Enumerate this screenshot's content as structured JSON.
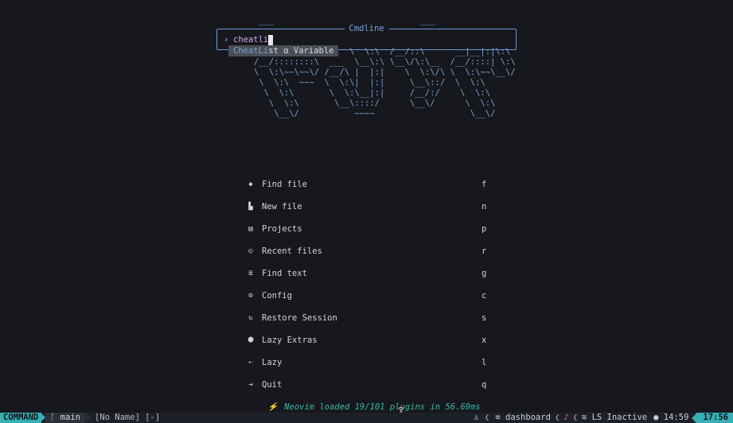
{
  "ascii_art": [
    "    ___                             ___",
    "",
    "",
    "    _____\\__\\:\\       \\  \\:\\  /__/::\\      __|__|:|\\:\\",
    "   /__/::::::::\\  ___  \\__\\:\\ \\__\\/\\:\\__  /__/::::| \\:\\",
    "   \\  \\:\\~~\\~~\\/ /__/\\ |  |:|    \\  \\:\\/\\ \\  \\:\\~~\\__\\/",
    "    \\  \\:\\  ~~~  \\  \\:\\|  |:|     \\__\\::/  \\  \\:\\",
    "     \\  \\:\\       \\  \\:\\__|:|     /__/:/    \\  \\:\\",
    "      \\  \\:\\       \\__\\::::/      \\__\\/      \\  \\:\\",
    "       \\__\\/           ~~~~                   \\__\\/"
  ],
  "cmdline": {
    "title": "Cmdline",
    "prompt": "›",
    "input": "cheatli"
  },
  "completion": {
    "match": "CheatLi",
    "rest": "st",
    "kind_icon": "α",
    "kind": "Variable"
  },
  "menu": [
    {
      "icon": "file-search-icon",
      "glyph": "◆",
      "label": "Find file",
      "key": "f"
    },
    {
      "icon": "new-file-icon",
      "glyph": "▙",
      "label": "New file",
      "key": "n"
    },
    {
      "icon": "projects-icon",
      "glyph": "▤",
      "label": "Projects",
      "key": "p"
    },
    {
      "icon": "recent-files-icon",
      "glyph": "◵",
      "label": "Recent files",
      "key": "r"
    },
    {
      "icon": "find-text-icon",
      "glyph": "≣",
      "label": "Find text",
      "key": "g"
    },
    {
      "icon": "config-icon",
      "glyph": "⚙",
      "label": "Config",
      "key": "c"
    },
    {
      "icon": "restore-session-icon",
      "glyph": "↻",
      "label": "Restore Session",
      "key": "s"
    },
    {
      "icon": "lazy-extras-icon",
      "glyph": "⬢",
      "label": "Lazy Extras",
      "key": "x"
    },
    {
      "icon": "lazy-icon",
      "glyph": "⇠",
      "label": "Lazy",
      "key": "l"
    },
    {
      "icon": "quit-icon",
      "glyph": "⇥",
      "label": "Quit",
      "key": "q"
    }
  ],
  "startup": {
    "icon": "⚡",
    "text": "Neovim loaded 19/101 plugins in 56.69ms"
  },
  "statusline": {
    "mode": "COMMAND",
    "branch_icon": "ᚴ",
    "branch": "main",
    "file": "[No Name] [-]",
    "filetype_icon": "♙",
    "filetype": "dashboard",
    "bell_icon": "🔔",
    "lsp_icon": "≋",
    "lsp": "LS Inactive",
    "clock_icon": "●",
    "clock": "14:59",
    "time": "17:56"
  },
  "colors": {
    "background": "#16181d",
    "accent": "#36b0b4",
    "border": "#6c9bd8",
    "startup_text": "#39b7a6"
  }
}
